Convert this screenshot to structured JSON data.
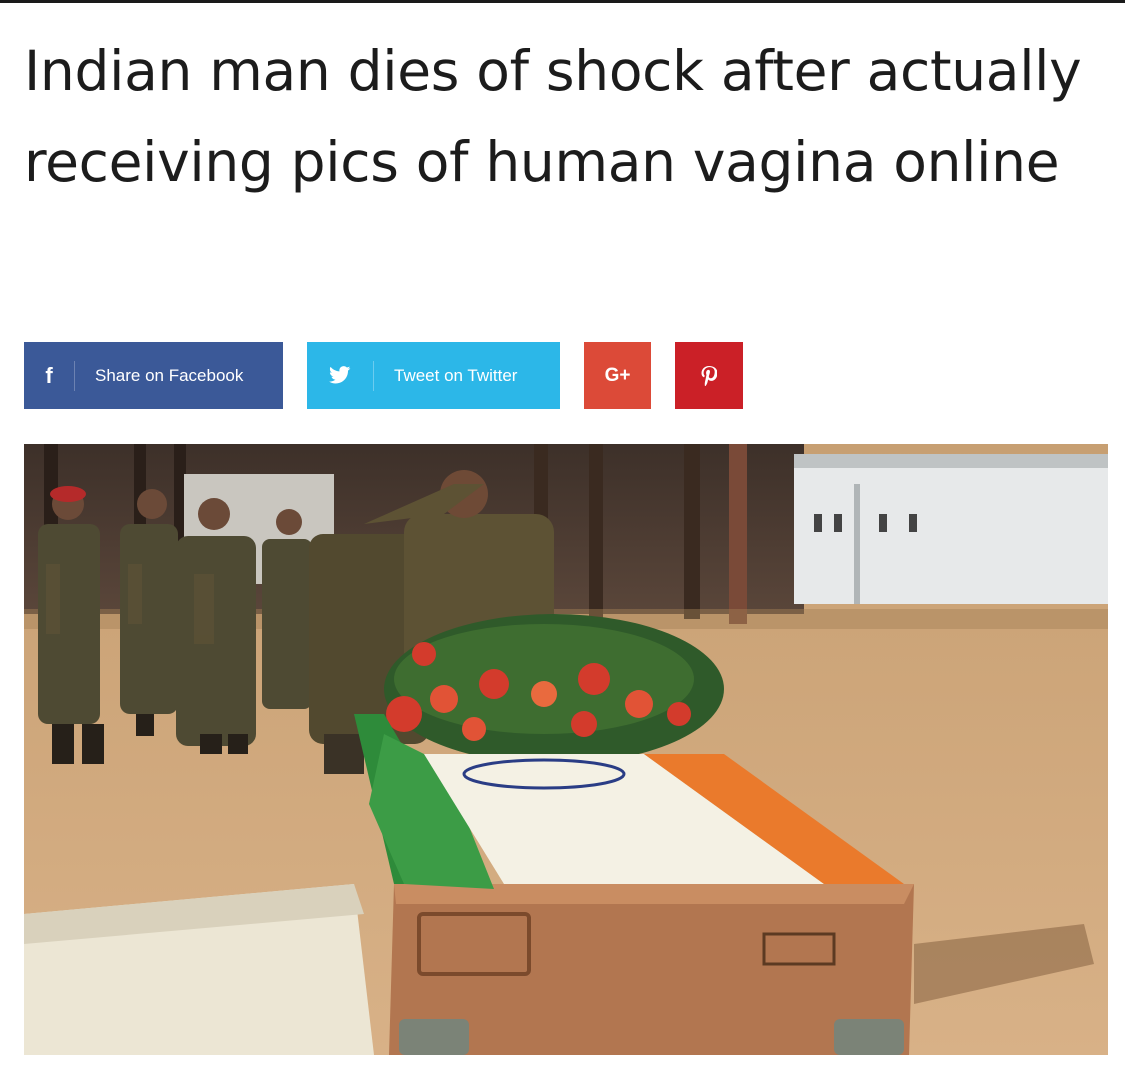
{
  "article": {
    "headline": "Indian man dies of shock after actually receiving pics of human vagina online"
  },
  "share": {
    "facebook": {
      "icon": "facebook-icon",
      "label": "Share on Facebook",
      "color": "#3b5998"
    },
    "twitter": {
      "icon": "twitter-bird-icon",
      "label": "Tweet on Twitter",
      "color": "#2cb7e8"
    },
    "google_plus": {
      "icon": "google-plus-icon",
      "label": "G+",
      "color": "#dc4a38"
    },
    "pinterest": {
      "icon": "pinterest-icon",
      "label": "p",
      "color": "#cb2027"
    }
  },
  "photo": {
    "description_icon": "article-photo"
  }
}
